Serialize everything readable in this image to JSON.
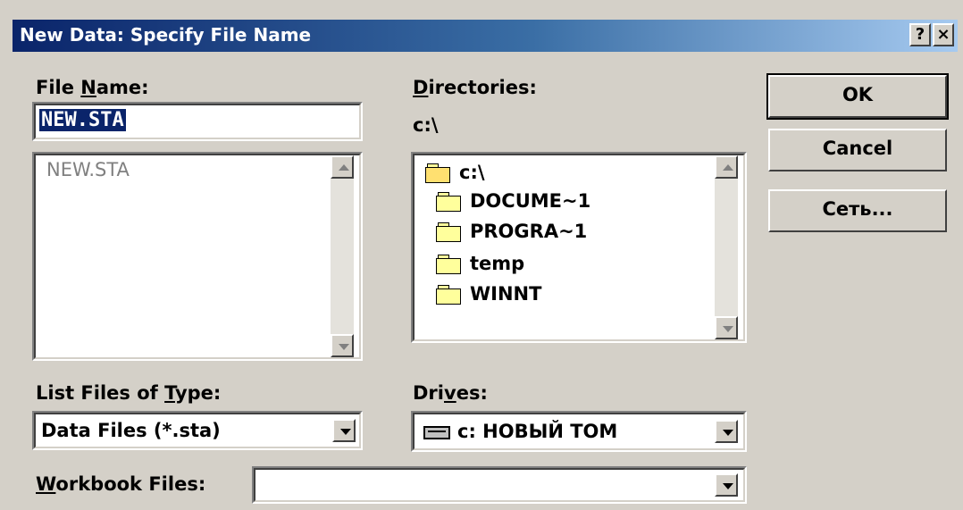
{
  "window": {
    "title": "New Data: Specify File Name",
    "help_label": "?",
    "close_label": "×"
  },
  "file_name": {
    "label_pre": "File ",
    "label_key": "N",
    "label_post": "ame:",
    "value": "NEW.STA",
    "list": [
      "NEW.STA"
    ]
  },
  "directories": {
    "label_key": "D",
    "label_post": "irectories:",
    "current": "c:\\",
    "items": [
      {
        "name": "c:\\",
        "icon": "open-folder-icon"
      },
      {
        "name": "DOCUME~1",
        "icon": "folder-icon"
      },
      {
        "name": "PROGRA~1",
        "icon": "folder-icon"
      },
      {
        "name": "temp",
        "icon": "folder-icon"
      },
      {
        "name": "WINNT",
        "icon": "folder-icon"
      }
    ]
  },
  "file_type": {
    "label_pre": "List Files of ",
    "label_key": "T",
    "label_post": "ype:",
    "value": "Data Files (*.sta)"
  },
  "drives": {
    "label_pre": "Dri",
    "label_key": "v",
    "label_post": "es:",
    "value": "c: НОВЫЙ ТОМ",
    "icon": "drive-icon"
  },
  "workbook": {
    "label_key": "W",
    "label_post": "orkbook Files:",
    "value": ""
  },
  "buttons": {
    "ok": "OK",
    "cancel": "Cancel",
    "network": "Сеть..."
  },
  "colors": {
    "title_start": "#0a246a",
    "title_end": "#a6caf0",
    "selection": "#0a246a",
    "face": "#d4d0c8"
  }
}
